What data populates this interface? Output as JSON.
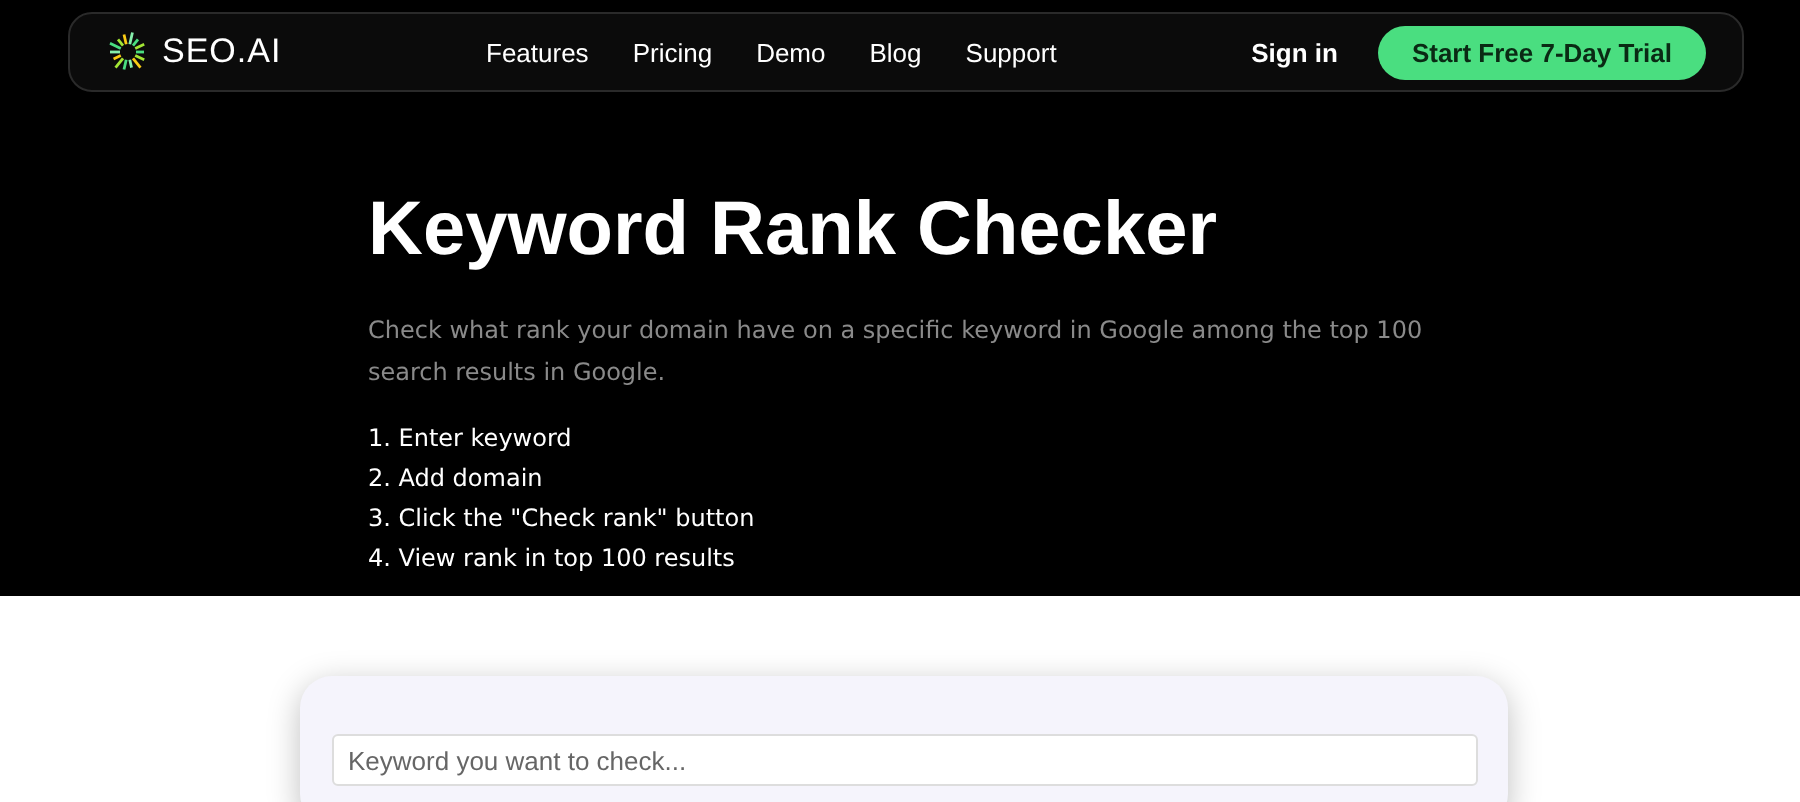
{
  "nav": {
    "logo": "SEO.AI",
    "links": [
      "Features",
      "Pricing",
      "Demo",
      "Blog",
      "Support"
    ],
    "sign_in": "Sign in",
    "cta": "Start Free 7-Day Trial"
  },
  "hero": {
    "title": "Keyword Rank Checker",
    "description": "Check what rank your domain have on a specific keyword in Google among the top 100 search results in Google.",
    "steps": [
      "1. Enter keyword",
      "2. Add domain",
      "3. Click the \"Check rank\" button",
      "4. View rank in top 100 results"
    ]
  },
  "form": {
    "keyword_placeholder": "Keyword you want to check..."
  }
}
